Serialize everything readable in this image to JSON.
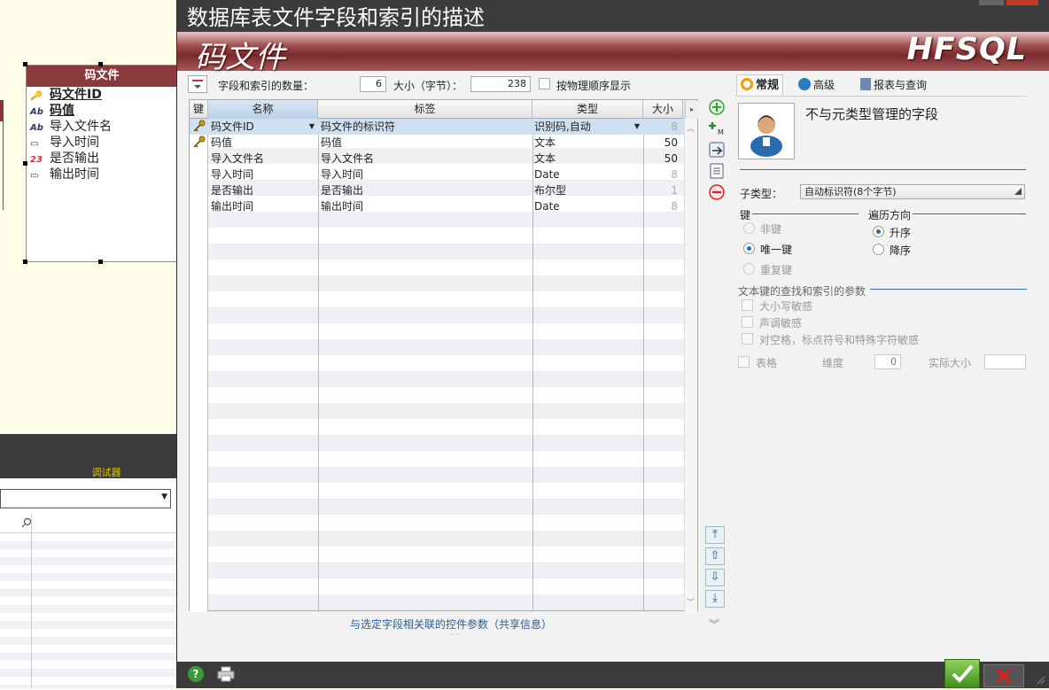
{
  "window_title": "数据库表文件字段和索引的描述",
  "banner": {
    "file_name": "码文件",
    "brand": "HFSQL"
  },
  "toolbar": {
    "count_label": "字段和索引的数量：",
    "count_value": "6",
    "size_label": "大小（字节）：",
    "size_value": "238",
    "physical_order_label": "按物理顺序显示"
  },
  "grid": {
    "headers": {
      "key": "键",
      "name": "名称",
      "caption": "标签",
      "type": "类型",
      "size": "大小"
    },
    "rows": [
      {
        "key": "unique",
        "name": "码文件ID",
        "caption": "码文件的标识符",
        "type": "识别码,自动",
        "size": "8",
        "selected": true
      },
      {
        "key": "duplicate",
        "name": "码值",
        "caption": "码值",
        "type": "文本",
        "size": "50",
        "selected": false
      },
      {
        "key": "",
        "name": "导入文件名",
        "caption": "导入文件名",
        "type": "文本",
        "size": "50",
        "selected": false
      },
      {
        "key": "",
        "name": "导入时间",
        "caption": "导入时间",
        "type": "Date",
        "size": "8",
        "selected": false
      },
      {
        "key": "",
        "name": "是否输出",
        "caption": "是否输出",
        "type": "布尔型",
        "size": "1",
        "selected": false
      },
      {
        "key": "",
        "name": "输出时间",
        "caption": "输出时间",
        "type": "Date",
        "size": "8",
        "selected": false
      }
    ]
  },
  "footer_link": "与选定字段相关联的控件参数（共享信息）",
  "right_panel": {
    "tabs": [
      {
        "label": "常规",
        "active": true
      },
      {
        "label": "高级",
        "active": false
      },
      {
        "label": "报表与查询",
        "active": false
      }
    ],
    "description": "不与元类型管理的字段",
    "subtype_label": "子类型：",
    "subtype_value": "自动标识符(8个字节)",
    "key_group": "键",
    "key_options": [
      {
        "label": "非键",
        "checked": false,
        "enabled": false
      },
      {
        "label": "唯一键",
        "checked": true,
        "enabled": true
      },
      {
        "label": "重复键",
        "checked": false,
        "enabled": false
      }
    ],
    "order_group": "遍历方向",
    "order_options": [
      {
        "label": "升序",
        "checked": true
      },
      {
        "label": "降序",
        "checked": false
      }
    ],
    "text_group": "文本键的查找和索引的参数",
    "text_options": [
      "大小写敏感",
      "声调敏感",
      "对空格，标点符号和特殊字符敏感"
    ],
    "array_label": "表格",
    "dimension_label": "维度",
    "dimension_value": "0",
    "actual_size_label": "实际大小"
  },
  "background": {
    "table_box": {
      "title": "码文件",
      "fields": [
        {
          "icon": "key-icon",
          "name": "码文件ID",
          "underline": true
        },
        {
          "icon": "text-icon",
          "name": "码值",
          "underline": true
        },
        {
          "icon": "text-icon",
          "name": "导入文件名",
          "underline": false
        },
        {
          "icon": "date-icon",
          "name": "导入时间",
          "underline": false
        },
        {
          "icon": "boolean-icon",
          "name": "是否输出",
          "underline": false
        },
        {
          "icon": "date-icon",
          "name": "输出时间",
          "underline": false
        }
      ]
    },
    "debugger_title": "调试器"
  },
  "colors": {
    "banner": "#8a3a3a",
    "accent": "#1a6fc4",
    "ok": "#4a9a2a",
    "cancel": "#d42020"
  }
}
